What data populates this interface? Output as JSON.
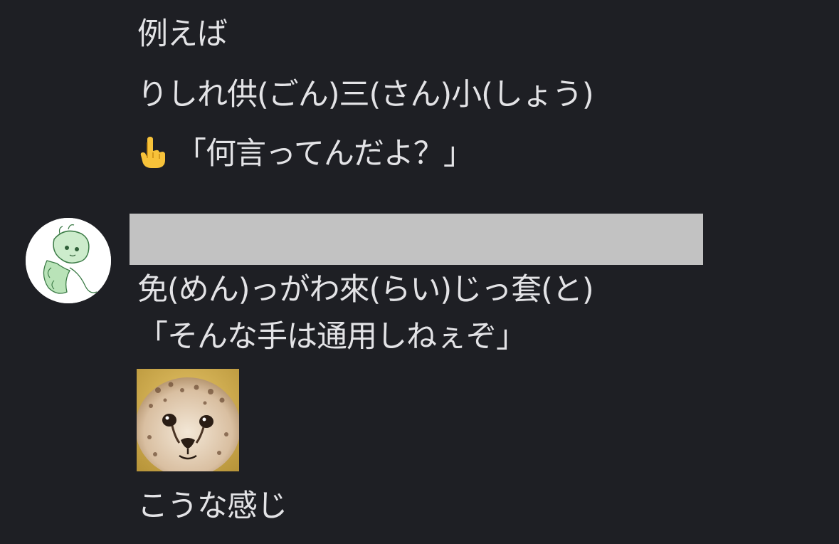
{
  "messages": {
    "line1": "例えば",
    "line2": "りしれ供(ごん)三(さん)小(しょう)",
    "line3_text": "「何言ってんだよ？」",
    "line3_emoji": "backhand-index-pointing-up-emoji",
    "reply_line1": "免(めん)っがわ來(らい)じっ套(と)",
    "reply_line2": "「そんな手は通用しねぇぞ」",
    "reply_line3": "こうな感じ"
  },
  "author": {
    "avatar": "avatar-sketch-character",
    "name_redacted": true
  },
  "sticker": {
    "icon": "cheetah-cub-face-sticker"
  },
  "colors": {
    "background": "#1e1f24",
    "text": "#e3e3e6",
    "redaction": "#c2c2c2"
  }
}
